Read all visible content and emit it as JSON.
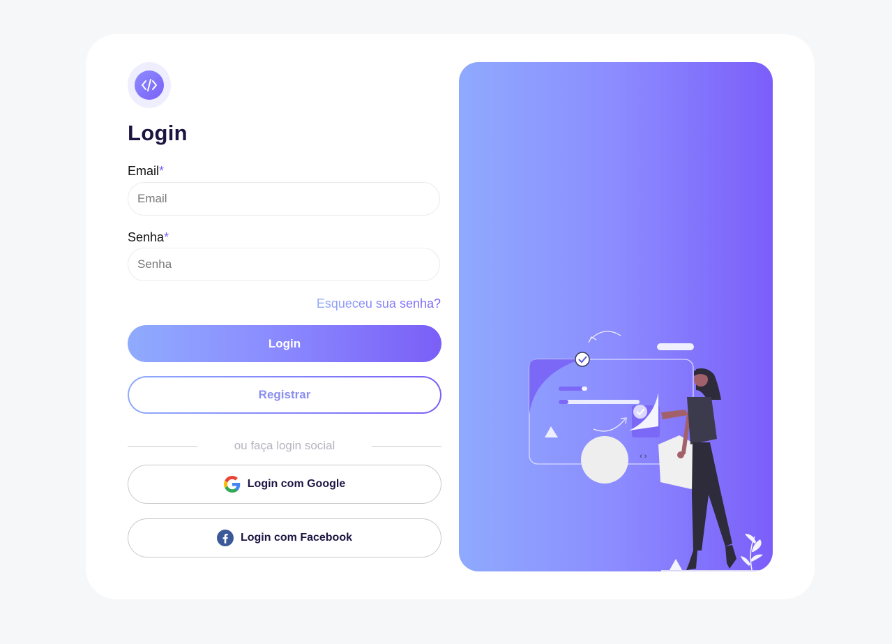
{
  "brand": {
    "logo_icon": "code-icon",
    "accent": "#7a61f7"
  },
  "form": {
    "title": "Login",
    "email": {
      "label": "Email",
      "required_mark": "*",
      "placeholder": "Email",
      "value": ""
    },
    "password": {
      "label": "Senha",
      "required_mark": "*",
      "placeholder": "Senha",
      "value": ""
    },
    "forgot_link": "Esqueceu sua senha?",
    "login_button": "Login",
    "register_button": "Registrar",
    "divider_text": "ou faça login social",
    "google_button": {
      "label": "Login com Google",
      "icon": "google-icon"
    },
    "facebook_button": {
      "label": "Login com Facebook",
      "icon": "facebook-icon"
    }
  },
  "illustration": {
    "name": "person-with-code-window",
    "gradient": [
      "#8eaafd",
      "#7b5ef9"
    ]
  }
}
